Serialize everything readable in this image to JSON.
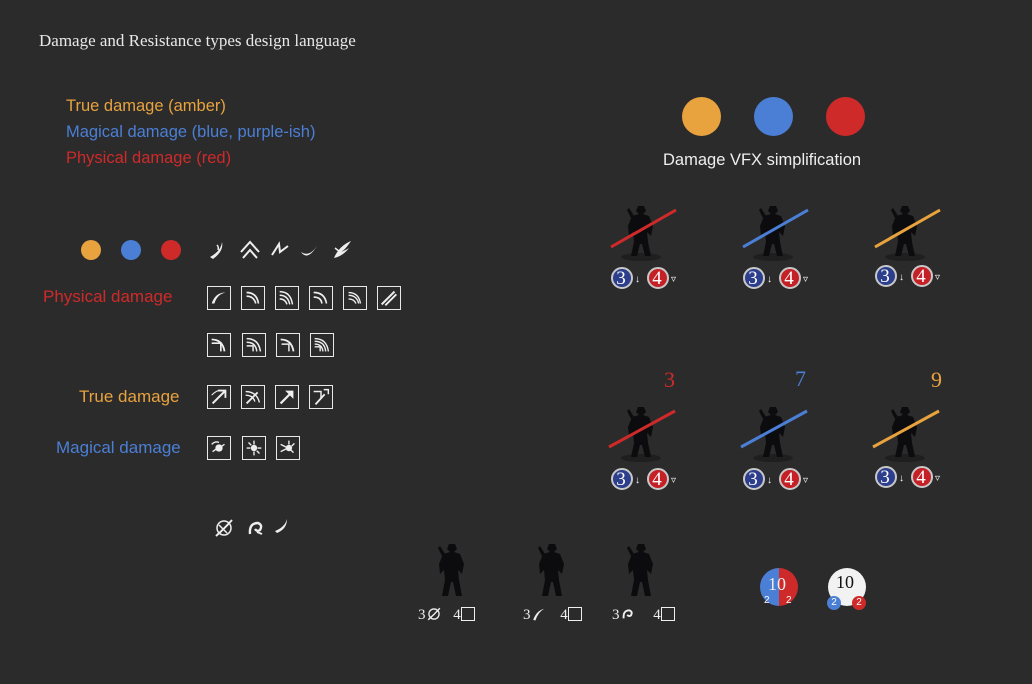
{
  "title": "Damage and Resistance types design language",
  "colors": {
    "true": "#e8a23e",
    "magical": "#4b7fd6",
    "physical": "#cf2a2a",
    "bg": "#2b2b2b"
  },
  "legend": {
    "true": "True damage (amber)",
    "magical": "Magical damage (blue, purple-ish)",
    "physical": "Physical damage (red)"
  },
  "vfx": {
    "caption": "Damage VFX simplification"
  },
  "rows": {
    "physical": "Physical damage",
    "true": "True damage",
    "magical": "Magical damage"
  },
  "units": {
    "armor": "3",
    "resist": "4",
    "damage_numbers": [
      "3",
      "7",
      "9"
    ]
  },
  "bottom": {
    "stat_a": "3",
    "stat_b": "4",
    "totals": [
      "10",
      "10"
    ],
    "split": [
      "2",
      "2"
    ]
  }
}
